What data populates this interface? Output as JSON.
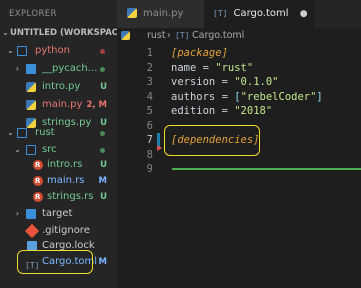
{
  "explorer": {
    "header": "EXPLORER",
    "section_title": "UNTITLED (WORKSPACE)",
    "rows": [
      {
        "name": "python-folder",
        "chevron": "⌄",
        "label": "python",
        "status": "",
        "dot": "red",
        "level": 0
      },
      {
        "name": "pycache-folder",
        "chevron": "›",
        "label": "__pycach...",
        "status": "",
        "dot": "green",
        "level": 1
      },
      {
        "name": "intro-py-file",
        "label": "intro.py",
        "status": "U",
        "level": 1
      },
      {
        "name": "main-py-file",
        "label": "main.py",
        "status": "2, M",
        "level": 1
      },
      {
        "name": "strings-py-file",
        "label": "strings.py",
        "status": "U",
        "level": 1
      },
      {
        "name": "rust-folder",
        "chevron": "⌄",
        "label": "rust",
        "status": "",
        "dot": "green",
        "level": 0
      },
      {
        "name": "src-folder",
        "chevron": "⌄",
        "label": "src",
        "status": "",
        "dot": "green",
        "level": 1
      },
      {
        "name": "intro-rs-file",
        "label": "intro.rs",
        "status": "U",
        "level": 2
      },
      {
        "name": "main-rs-file",
        "label": "main.rs",
        "status": "M",
        "level": 2
      },
      {
        "name": "strings-rs-file",
        "label": "strings.rs",
        "status": "U",
        "level": 2
      },
      {
        "name": "target-folder",
        "chevron": "›",
        "label": "target",
        "status": "",
        "level": 1
      },
      {
        "name": "gitignore-file",
        "label": ".gitignore",
        "status": "",
        "level": 1
      },
      {
        "name": "cargo-lock-file",
        "label": "Cargo.lock",
        "status": "",
        "level": 1
      },
      {
        "name": "cargo-toml-file",
        "label": "Cargo.toml",
        "status": "M",
        "level": 1
      }
    ]
  },
  "tabs": [
    {
      "label": "main.py",
      "active": false
    },
    {
      "label": "Cargo.toml",
      "active": true,
      "modified_dot": "●"
    }
  ],
  "breadcrumb": {
    "folder": "rust",
    "separator": "›",
    "file": "Cargo.toml"
  },
  "editor": {
    "lines": [
      {
        "n": "1",
        "segments": [
          {
            "t": "[package]",
            "c": "k-orange"
          }
        ]
      },
      {
        "n": "2",
        "segments": [
          {
            "t": "name",
            "c": "k-key"
          },
          {
            "t": " = ",
            "c": "k-eq"
          },
          {
            "t": "\"rust\"",
            "c": "k-str"
          }
        ]
      },
      {
        "n": "3",
        "segments": [
          {
            "t": "version",
            "c": "k-key"
          },
          {
            "t": " = ",
            "c": "k-eq"
          },
          {
            "t": "\"0.1.0\"",
            "c": "k-str"
          }
        ]
      },
      {
        "n": "4",
        "segments": [
          {
            "t": "authors",
            "c": "k-key"
          },
          {
            "t": " = ",
            "c": "k-eq"
          },
          {
            "t": "[",
            "c": "k-punc"
          },
          {
            "t": "\"rebelCoder\"",
            "c": "k-str"
          },
          {
            "t": "]",
            "c": "k-punc"
          }
        ]
      },
      {
        "n": "5",
        "segments": [
          {
            "t": "edition",
            "c": "k-key"
          },
          {
            "t": " = ",
            "c": "k-eq"
          },
          {
            "t": "\"2018\"",
            "c": "k-str"
          }
        ]
      },
      {
        "n": "6",
        "segments": []
      },
      {
        "n": "7",
        "segments": [
          {
            "t": "[dependencies]",
            "c": "k-orange"
          }
        ]
      },
      {
        "n": "8",
        "segments": []
      },
      {
        "n": "9",
        "segments": []
      }
    ]
  },
  "colors": {
    "highlight": "#f0dc2b",
    "modified_blue": "#7cb7ff",
    "untracked_green": "#73c991",
    "error_red": "#e5766f"
  }
}
